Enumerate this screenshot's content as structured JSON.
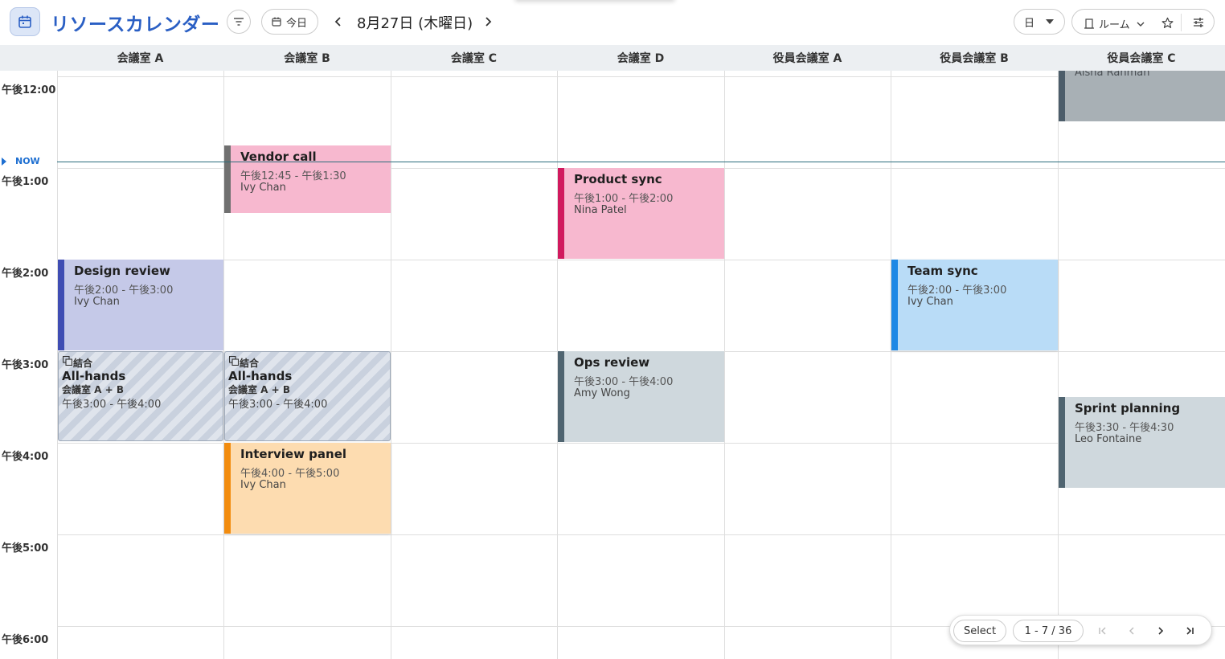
{
  "header": {
    "app_title": "リソースカレンダー",
    "today_label": "今日",
    "date": "8月27日 (木曜日)",
    "view_label": "日",
    "resource_label": "ルーム",
    "icons": [
      "calendar-icon",
      "filter-icon",
      "chevron-left-icon",
      "chevron-right-icon",
      "star-icon",
      "settings-sliders-icon"
    ]
  },
  "rooms": [
    {
      "label": "会議室 A"
    },
    {
      "label": "会議室 B"
    },
    {
      "label": "会議室 C"
    },
    {
      "label": "会議室 D"
    },
    {
      "label": "役員会議室 A"
    },
    {
      "label": "役員会議室 B"
    },
    {
      "label": "役員会議室 C"
    }
  ],
  "time_labels": [
    "午後12:00",
    "午後1:00",
    "午後2:00",
    "午後3:00",
    "午後4:00",
    "午後5:00",
    "午後6:00"
  ],
  "now_label": "NOW",
  "events": {
    "aisha": {
      "person": "Aisha Rahman"
    },
    "vendor": {
      "title": "Vendor call",
      "time": "午後12:45 - 午後1:30",
      "person": "Ivy Chan"
    },
    "product": {
      "title": "Product sync",
      "time": "午後1:00 - 午後2:00",
      "person": "Nina Patel"
    },
    "design": {
      "title": "Design review",
      "time": "午後2:00 - 午後3:00",
      "person": "Ivy Chan"
    },
    "team": {
      "title": "Team sync",
      "time": "午後2:00 - 午後3:00",
      "person": "Ivy Chan"
    },
    "allhands_a": {
      "tag": "結合",
      "title": "All-hands",
      "rooms": "会議室 A + B",
      "time": "午後3:00 - 午後4:00"
    },
    "allhands_b": {
      "tag": "結合",
      "title": "All-hands",
      "rooms": "会議室 A + B",
      "time": "午後3:00 - 午後4:00"
    },
    "ops": {
      "title": "Ops review",
      "time": "午後3:00 - 午後4:00",
      "person": "Amy Wong"
    },
    "sprint": {
      "title": "Sprint planning",
      "time": "午後3:30 - 午後4:30",
      "person": "Leo Fontaine"
    },
    "interview": {
      "title": "Interview panel",
      "time": "午後4:00 - 午後5:00",
      "person": "Ivy Chan"
    }
  },
  "colors": {
    "accent": "#2a5fc4",
    "pink_bg": "#f7b8cf",
    "lavender_bg": "#c5c9e8",
    "blue_bg": "#b9dcf7",
    "gray_bg": "#cfd8dd",
    "orange_bg": "#fddcb0"
  },
  "pager": {
    "select_label": "Select",
    "range_label": "1 - 7 / 36"
  }
}
